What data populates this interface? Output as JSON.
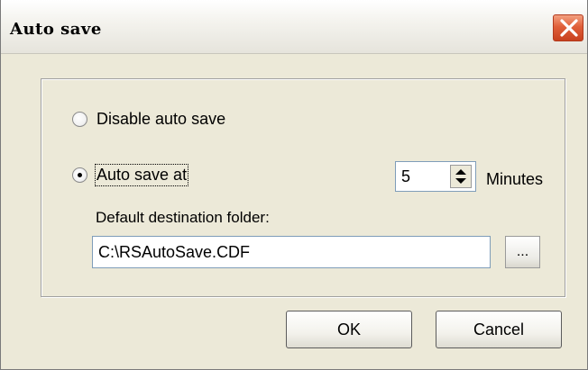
{
  "window": {
    "title": "Auto save",
    "close_icon": "close-icon",
    "accent_close": "#d9532b"
  },
  "options": {
    "disable_label": "Disable auto save",
    "disable_selected": false,
    "autosave_label": "Auto save at",
    "autosave_selected": true
  },
  "interval": {
    "value": "5",
    "unit_label": "Minutes",
    "spinner_icon": "up-down-arrows-icon"
  },
  "destination": {
    "label": "Default destination folder:",
    "path_value": "C:\\RSAutoSave.CDF",
    "browse_label": "..."
  },
  "buttons": {
    "ok_label": "OK",
    "cancel_label": "Cancel"
  }
}
